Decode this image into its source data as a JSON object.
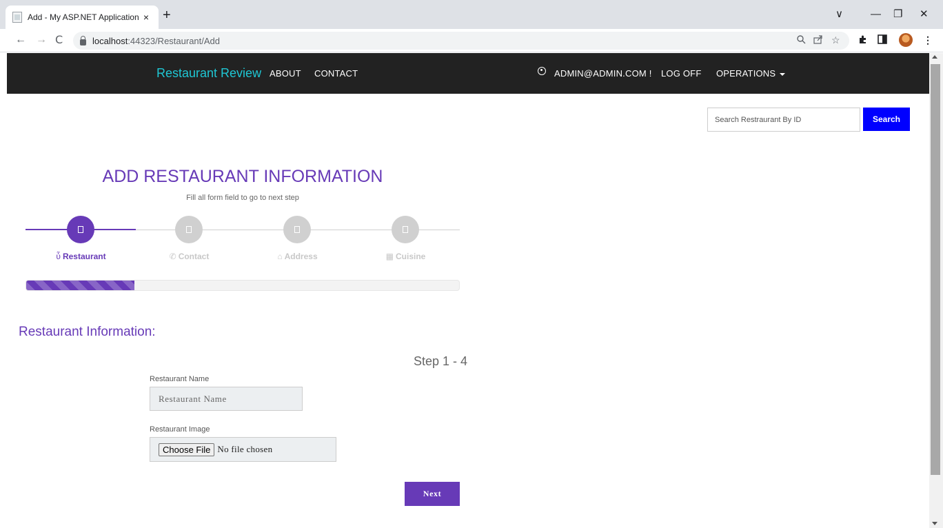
{
  "browser": {
    "tab_title": "Add - My ASP.NET Application",
    "tab_close": "×",
    "new_tab": "+",
    "url_host": "localhost",
    "url_rest": ":44323/Restaurant/Add",
    "back": "←",
    "forward": "→",
    "reload": "C",
    "minimize": "—",
    "restore": "❐",
    "close": "✕",
    "tab_search": "∨",
    "icons": [
      "zoom-icon",
      "share-icon",
      "bookmark-star-icon",
      "extensions-icon",
      "side-panel-icon",
      "profile-avatar",
      "menu-icon"
    ]
  },
  "navbar": {
    "brand": "Restaurant Review",
    "about": "ABOUT",
    "contact": "CONTACT",
    "user": "ADMIN@ADMIN.COM !",
    "logoff": "LOG OFF",
    "operations": "OPERATIONS"
  },
  "search": {
    "placeholder": "Search Restraurant By ID",
    "button": "Search"
  },
  "heading": {
    "title": "ADD RESTAURANT INFORMATION",
    "subtitle": "Fill all form field to go to next step"
  },
  "stepper": {
    "steps": [
      {
        "label": "Restaurant",
        "icon": "ὗ",
        "active": true
      },
      {
        "label": "Contact",
        "icon": "✆",
        "active": false
      },
      {
        "label": "Address",
        "icon": "⌂",
        "active": false
      },
      {
        "label": "Cuisine",
        "icon": "▦",
        "active": false
      }
    ],
    "progress": 0.25,
    "active_color": "#673ab7",
    "inactive_color": "#d0d0d0"
  },
  "form": {
    "section_title": "Restaurant Information:",
    "step_count": "Step 1 - 4",
    "name_label": "Restaurant Name",
    "name_placeholder": "Restaurant Name",
    "name_value": "",
    "image_label": "Restaurant Image",
    "choose_file": "Choose File",
    "file_status": "No file chosen",
    "next": "Next"
  },
  "colors": {
    "accent": "#673ab7",
    "brand": "#1fc7d4",
    "navbar_bg": "#222222",
    "search_button": "#0000ff"
  }
}
